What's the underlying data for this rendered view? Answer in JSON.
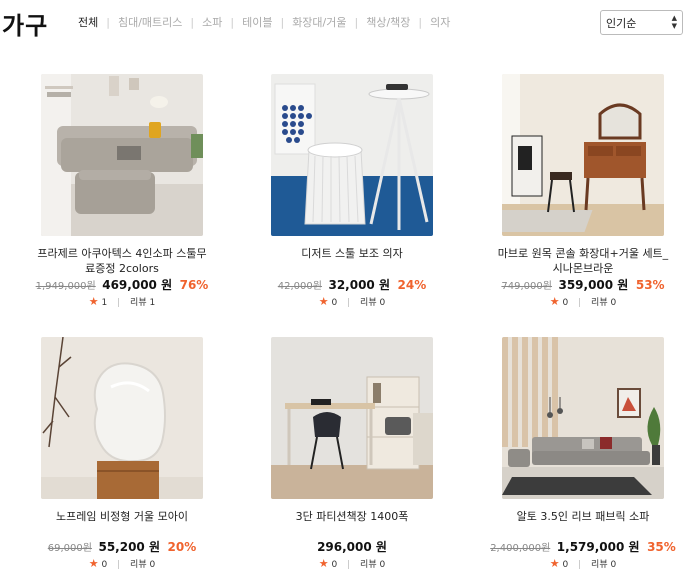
{
  "header": {
    "title": "가구",
    "tabs": [
      "전체",
      "침대/매트리스",
      "소파",
      "테이블",
      "화장대/거울",
      "책상/책장",
      "의자"
    ],
    "sort": {
      "selected": "인기순"
    }
  },
  "colors": {
    "accent": "#f0632e",
    "star": "#f0632e"
  },
  "products": [
    {
      "name_lines": [
        "프라제르 아쿠아텍스 4인소파 스툴무",
        "료증정 2colors"
      ],
      "original_price": "1,949,000원",
      "price": "469,000 원",
      "discount": "76%",
      "rating": "1",
      "review_label": "리뷰",
      "review_count": "1"
    },
    {
      "name_lines": [
        "디저트 스툴 보조 의자"
      ],
      "original_price": "42,000원",
      "price": "32,000 원",
      "discount": "24%",
      "rating": "0",
      "review_label": "리뷰",
      "review_count": "0"
    },
    {
      "name_lines": [
        "마브로 원목 콘솔 화장대+거울 세트_",
        "시나몬브라운"
      ],
      "original_price": "749,000원",
      "price": "359,000 원",
      "discount": "53%",
      "rating": "0",
      "review_label": "리뷰",
      "review_count": "0"
    },
    {
      "name_lines": [
        "노프레임 비정형 거울 모아이"
      ],
      "original_price": "69,000원",
      "price": "55,200 원",
      "discount": "20%",
      "rating": "0",
      "review_label": "리뷰",
      "review_count": "0"
    },
    {
      "name_lines": [
        "3단 파티션책장 1400폭"
      ],
      "original_price": "",
      "price": "296,000 원",
      "discount": "",
      "rating": "0",
      "review_label": "리뷰",
      "review_count": "0"
    },
    {
      "name_lines": [
        "알토 3.5인 리브 패브릭 소파"
      ],
      "original_price": "2,400,000원",
      "price": "1,579,000 원",
      "discount": "35%",
      "rating": "0",
      "review_label": "리뷰",
      "review_count": "0"
    }
  ]
}
